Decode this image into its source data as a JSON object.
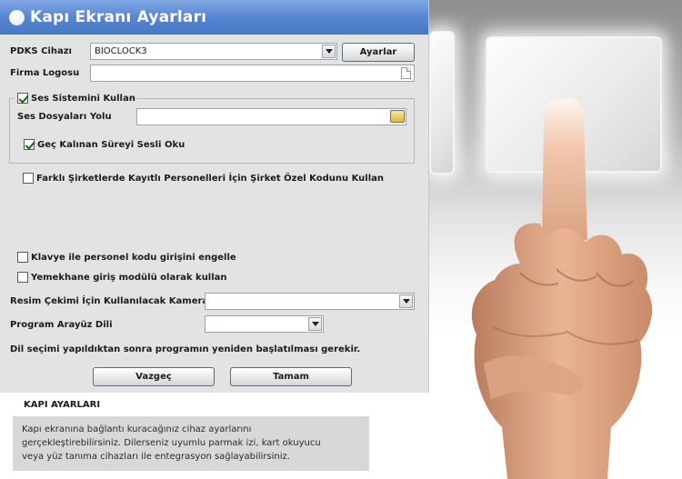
{
  "window": {
    "title": "Kapı Ekranı Ayarları"
  },
  "pdks": {
    "label": "PDKS Cihazı",
    "value": "BIOCLOCK3",
    "settings_button": "Ayarlar"
  },
  "logo": {
    "label": "Firma Logosu",
    "value": ""
  },
  "sound": {
    "use_label": "Ses Sistemini Kullan",
    "use_checked": true,
    "path_label": "Ses Dosyaları Yolu",
    "path_value": "",
    "late_label": "Geç Kalınan Süreyi Sesli Oku",
    "late_checked": true
  },
  "company_code": {
    "label": "Farklı Şirketlerde Kayıtlı Personelleri İçin Şirket Özel Kodunu Kullan",
    "checked": false
  },
  "keyboard_block": {
    "label": "Klavye ile personel kodu girişini engelle",
    "checked": false
  },
  "cafeteria": {
    "label": "Yemekhane giriş modülü olarak kullan",
    "checked": false
  },
  "camera": {
    "label": "Resim Çekimi İçin Kullanılacak Kamera",
    "value": ""
  },
  "language": {
    "label": "Program Arayüz Dili",
    "value": ""
  },
  "restart_note": "Dil seçimi yapıldıktan sonra programın yeniden başlatılması gerekir.",
  "buttons": {
    "cancel": "Vazgeç",
    "ok": "Tamam"
  },
  "info": {
    "title": "KAPI AYARLARI",
    "line1": "Kapı ekranına bağlantı kuracağınız cihaz ayarlarını",
    "line2": "gerçekleştirebilirsiniz. Dilerseniz uyumlu parmak izi, kart okuyucu",
    "line3": "veya yüz tanıma cihazları ile entegrasyon sağlayabilirsiniz."
  },
  "colors": {
    "titlebar": "#5483d0",
    "dialog_bg": "#e3e3e3",
    "check": "#0f6a12"
  }
}
